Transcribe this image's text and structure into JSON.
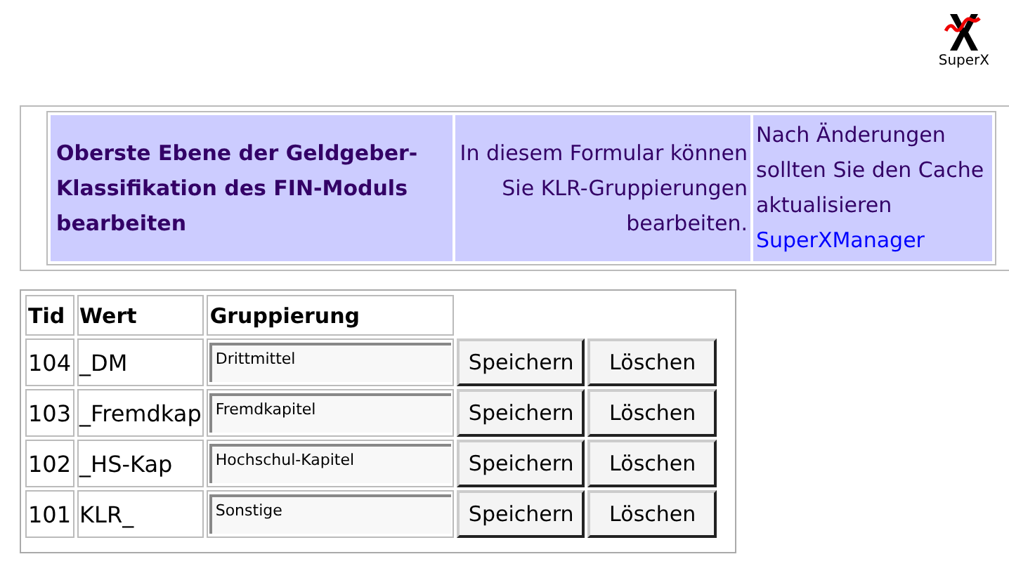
{
  "logo": {
    "caption": "SuperX"
  },
  "header": {
    "title": "Oberste Ebene der Geldgeber-Klassifikation des FIN-Moduls bearbeiten",
    "description": "In diesem Formular können Sie KLR-Gruppierungen bearbeiten.",
    "note": "Nach Änderungen sollten Sie den Cache aktualisieren",
    "link": "SuperXManager"
  },
  "table": {
    "columns": [
      "Tid",
      "Wert",
      "Gruppierung"
    ],
    "rows": [
      {
        "tid": "104",
        "wert": "_DM",
        "gruppierung": "Drittmittel",
        "save": "Speichern",
        "delete": "Löschen"
      },
      {
        "tid": "103",
        "wert": "_Fremdkap",
        "gruppierung": "Fremdkapitel",
        "save": "Speichern",
        "delete": "Löschen"
      },
      {
        "tid": "102",
        "wert": "_HS-Kap",
        "gruppierung": "Hochschul-Kapitel",
        "save": "Speichern",
        "delete": "Löschen"
      },
      {
        "tid": "101",
        "wert": "KLR_",
        "gruppierung": "Sonstige",
        "save": "Speichern",
        "delete": "Löschen"
      }
    ]
  }
}
